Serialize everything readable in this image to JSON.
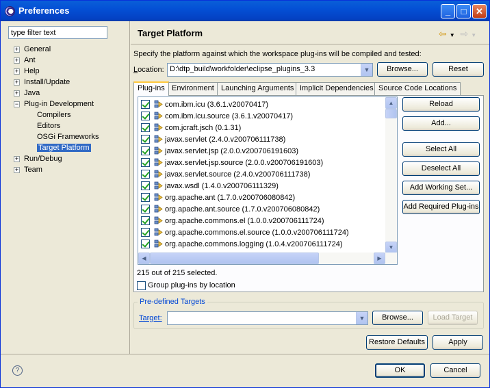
{
  "window": {
    "title": "Preferences"
  },
  "filter": {
    "placeholder": "type filter text",
    "value": "type filter text"
  },
  "tree": [
    {
      "label": "General",
      "expander": "+",
      "level": 0
    },
    {
      "label": "Ant",
      "expander": "+",
      "level": 0
    },
    {
      "label": "Help",
      "expander": "+",
      "level": 0
    },
    {
      "label": "Install/Update",
      "expander": "+",
      "level": 0
    },
    {
      "label": "Java",
      "expander": "+",
      "level": 0
    },
    {
      "label": "Plug-in Development",
      "expander": "−",
      "level": 0
    },
    {
      "label": "Compilers",
      "expander": "",
      "level": 1
    },
    {
      "label": "Editors",
      "expander": "",
      "level": 1
    },
    {
      "label": "OSGi Frameworks",
      "expander": "",
      "level": 1
    },
    {
      "label": "Target Platform",
      "expander": "",
      "level": 1,
      "selected": true
    },
    {
      "label": "Run/Debug",
      "expander": "+",
      "level": 0
    },
    {
      "label": "Team",
      "expander": "+",
      "level": 0
    }
  ],
  "page": {
    "title": "Target Platform",
    "description": "Specify the platform against which the workspace plug-ins will be compiled and tested:",
    "location_label": "Location:",
    "location_value": "D:\\dtp_build\\workfolder\\eclipse_plugins_3.3",
    "browse_label": "Browse...",
    "reset_label": "Reset"
  },
  "tabs": [
    "Plug-ins",
    "Environment",
    "Launching Arguments",
    "Implicit Dependencies",
    "Source Code Locations"
  ],
  "plugins": [
    "com.ibm.icu (3.6.1.v20070417)",
    "com.ibm.icu.source (3.6.1.v20070417)",
    "com.jcraft.jsch (0.1.31)",
    "javax.servlet (2.4.0.v200706111738)",
    "javax.servlet.jsp (2.0.0.v200706191603)",
    "javax.servlet.jsp.source (2.0.0.v200706191603)",
    "javax.servlet.source (2.4.0.v200706111738)",
    "javax.wsdl (1.4.0.v200706111329)",
    "org.apache.ant (1.7.0.v200706080842)",
    "org.apache.ant.source (1.7.0.v200706080842)",
    "org.apache.commons.el (1.0.0.v200706111724)",
    "org.apache.commons.el.source (1.0.0.v200706111724)",
    "org.apache.commons.logging (1.0.4.v200706111724)"
  ],
  "plugin_buttons": {
    "reload": "Reload",
    "add": "Add...",
    "select_all": "Select All",
    "deselect_all": "Deselect All",
    "add_working_set": "Add Working Set...",
    "add_required": "Add Required Plug-ins"
  },
  "selection_status": "215 out of 215 selected.",
  "group_by_location": "Group plug-ins by location",
  "predefined": {
    "title": "Pre-defined Targets",
    "target_label": "Target:",
    "target_value": "",
    "browse_label": "Browse...",
    "load_label": "Load Target"
  },
  "restore_defaults": "Restore Defaults",
  "apply": "Apply",
  "ok": "OK",
  "cancel": "Cancel",
  "help_symbol": "?",
  "colors": {
    "selection": "#316ac5",
    "titlebar": "#0450d5",
    "link_blue": "#0046d5"
  }
}
